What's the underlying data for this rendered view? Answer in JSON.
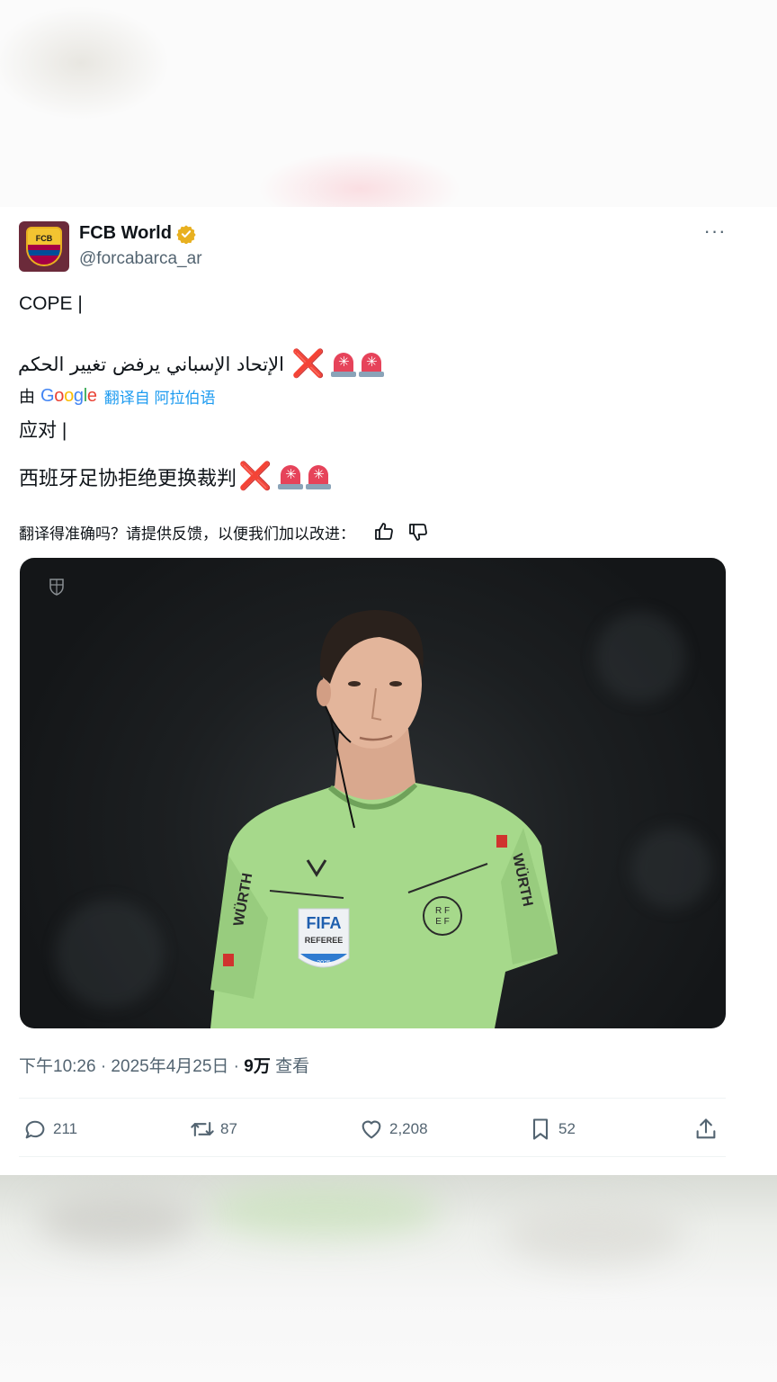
{
  "tweet": {
    "author": {
      "name": "FCB World",
      "handle": "@forcabarca_ar",
      "avatar_text": "FCB",
      "verified": true
    },
    "more_label": "···",
    "lines": {
      "cope": "COPE |",
      "arabic": "الإتحاد الإسباني يرفض تغيير الحكم",
      "translate_by": "由",
      "google": [
        "G",
        "o",
        "o",
        "g",
        "l",
        "e"
      ],
      "translate_link": "翻译自 阿拉伯语",
      "yingdui": "应对 |",
      "chinese": "西班牙足协拒绝更换裁判"
    },
    "emoji": {
      "cross": "❌",
      "siren": "🚨"
    },
    "feedback": {
      "prompt": "翻译得准确吗？请提供反馈，以便我们加以改进：",
      "like_icon": "thumbs-up-icon",
      "dislike_icon": "thumbs-down-icon"
    },
    "media": {
      "description_icon": "fcb-crest-watermark-icon",
      "shirt_text": {
        "sponsor": "WÜRTH",
        "fifa": "FIFA",
        "referee": "REFEREE",
        "year": "2025",
        "rfef": [
          "R F",
          "E F"
        ]
      }
    },
    "meta": {
      "time": "下午10:26 · 2025年4月25日 · ",
      "views_count": "9万",
      "views_label": " 查看"
    },
    "actions": {
      "reply": "211",
      "retweet": "87",
      "like": "2,208",
      "bookmark": "52"
    }
  },
  "colors": {
    "text": "#0f1419",
    "secondary": "#536471",
    "link": "#1d9bf0",
    "verified": "#e8b020",
    "cross": "#dd2e44",
    "siren": "#e6435a",
    "shirt": "#a6d98b"
  }
}
